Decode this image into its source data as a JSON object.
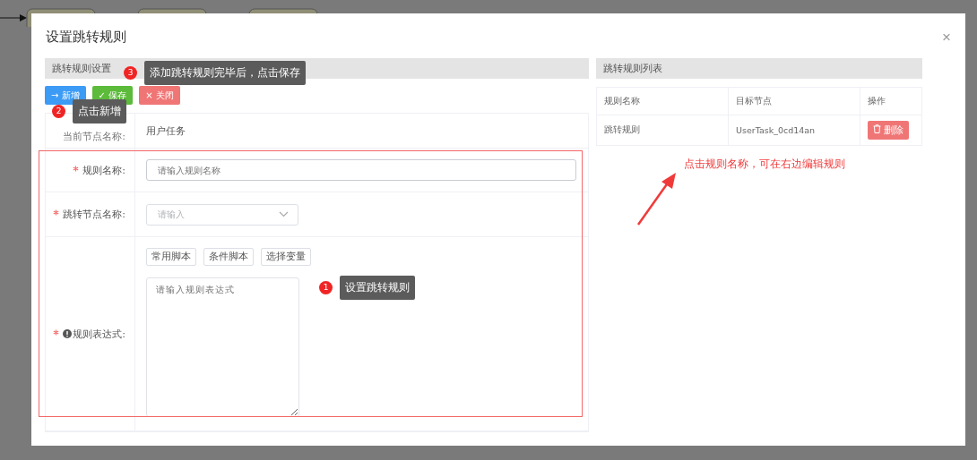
{
  "dialog": {
    "title": "设置跳转规则",
    "close": "×"
  },
  "left_panel": {
    "header": "跳转规则设置",
    "buttons": [
      {
        "kind": "primary",
        "icon": "→",
        "label": "新增"
      },
      {
        "kind": "success",
        "icon": "✓",
        "label": "保存"
      },
      {
        "kind": "danger",
        "icon": "×",
        "label": "关闭"
      }
    ],
    "current_node": {
      "label": "当前节点名称:",
      "value": "用户任务"
    },
    "form": {
      "rule_name": {
        "label": "规则名称:",
        "required": true,
        "placeholder": "请输入规则名称"
      },
      "jump_node": {
        "label": "跳转节点名称:",
        "required": true,
        "placeholder": "请输入"
      },
      "expression": {
        "label": "规则表达式:",
        "required": true,
        "placeholder": "请输入规则表达式",
        "script_buttons": [
          "常用脚本",
          "条件脚本",
          "选择变量"
        ]
      }
    }
  },
  "right_panel": {
    "header": "跳转规则列表",
    "columns": [
      "规则名称",
      "目标节点",
      "操作"
    ],
    "rows": [
      {
        "name": "跳转规则",
        "target": "UserTask_0cd14an",
        "action": "删除"
      }
    ]
  },
  "annotations": [
    {
      "number": "3",
      "text": "添加跳转规则完毕后，点击保存"
    },
    {
      "number": "2",
      "text": "点击新增"
    },
    {
      "number": "1",
      "text": "设置跳转规则"
    }
  ],
  "hint": "点击规则名称，可在右边编辑规则"
}
